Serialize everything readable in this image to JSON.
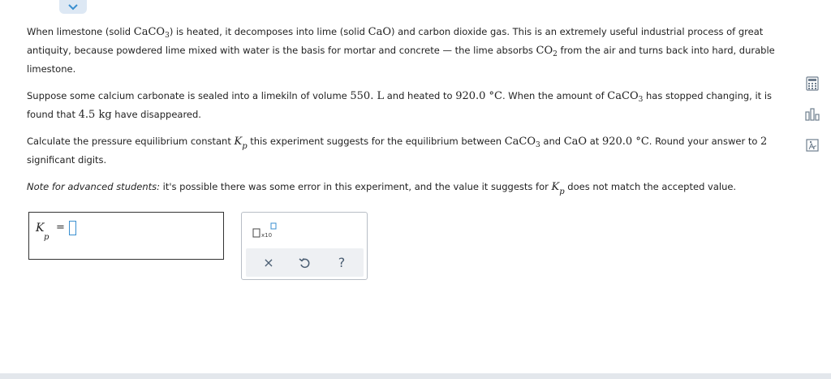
{
  "collapse_icon": "chevron-down-icon",
  "question": {
    "p1": {
      "t1": "When limestone (solid ",
      "caco3_base": "CaCO",
      "caco3_sub": "3",
      "t2": ") is heated, it decomposes into lime (solid ",
      "cao": "CaO",
      "t3": ") and carbon dioxide gas. This is an extremely useful industrial process of great antiquity, because powdered lime mixed with water is the basis for mortar and concrete — the lime absorbs ",
      "co2_base": "CO",
      "co2_sub": "2",
      "t4": " from the air and turns back into hard, durable limestone."
    },
    "p2": {
      "t1": "Suppose some calcium carbonate is sealed into a limekiln of volume ",
      "volume": "550. L",
      "t2": " and heated to ",
      "temp": "920.0 °C",
      "t3": ". When the amount of ",
      "caco3_base": "CaCO",
      "caco3_sub": "3",
      "t4": " has stopped changing, it is found that ",
      "mass": "4.5 kg",
      "t5": " have disappeared."
    },
    "p3": {
      "t1": "Calculate the pressure equilibrium constant ",
      "k": "K",
      "p": "p",
      "t2": " this experiment suggests for the equilibrium between ",
      "caco3_base": "CaCO",
      "caco3_sub": "3",
      "t3": " and ",
      "cao": "CaO",
      "t4": " at ",
      "temp": "920.0 °C",
      "t5": ". Round your answer to ",
      "digits": "2",
      "t6": " significant digits."
    },
    "p4": {
      "label": "Note for advanced students:",
      "t1": " it's possible there was some error in this experiment, and the value it suggests for ",
      "k": "K",
      "p": "p",
      "t2": " does not match the accepted value."
    }
  },
  "answer": {
    "k": "K",
    "p": "p",
    "equals": "=",
    "value": ""
  },
  "toolbox": {
    "sci_icon": "scientific-notation-icon",
    "clear_label": "×",
    "undo_icon": "undo-icon",
    "help_label": "?"
  },
  "side_tools": [
    "calculator-icon",
    "bar-chart-icon",
    "periodic-table-icon"
  ],
  "colors": {
    "accent": "#3a8fd0",
    "tool_row_bg": "#eef0f3",
    "tab_bg": "#dde8f4"
  }
}
